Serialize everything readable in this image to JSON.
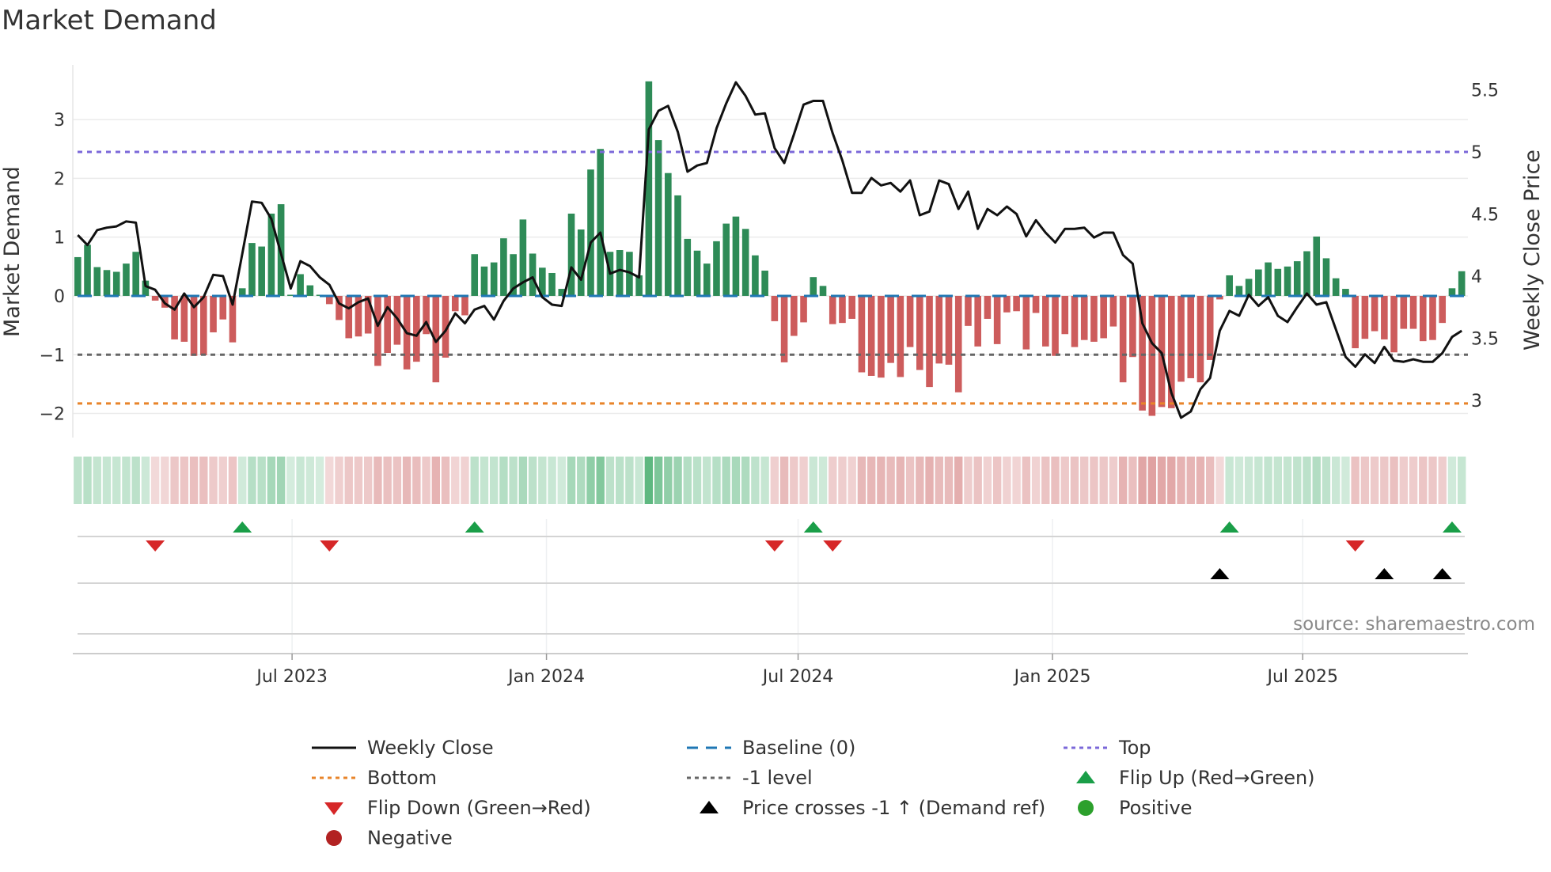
{
  "title": "Market Demand",
  "source": "source: sharemaestro.com",
  "legend": [
    {
      "key": "weekly_close",
      "label": "Weekly Close",
      "color": "#111111",
      "style": "line"
    },
    {
      "key": "baseline",
      "label": "Baseline (0)",
      "color": "#1f77b4",
      "style": "dash"
    },
    {
      "key": "top",
      "label": "Top",
      "color": "#7b68d9",
      "style": "dot"
    },
    {
      "key": "bottom",
      "label": "Bottom",
      "color": "#e8842a",
      "style": "dot"
    },
    {
      "key": "minus1",
      "label": "-1 level",
      "color": "#666666",
      "style": "dot"
    },
    {
      "key": "flip_up",
      "label": "Flip Up (Red→Green)",
      "color": "#1a9e48",
      "style": "tri-up"
    },
    {
      "key": "flip_down",
      "label": "Flip Down (Green→Red)",
      "color": "#d62728",
      "style": "tri-down"
    },
    {
      "key": "price_cross",
      "label": "Price crosses -1 ↑ (Demand ref)",
      "color": "#000000",
      "style": "tri-up"
    },
    {
      "key": "positive",
      "label": "Positive",
      "color": "#2ca02c",
      "style": "circle"
    },
    {
      "key": "negative",
      "label": "Negative",
      "color": "#b22222",
      "style": "circle"
    }
  ],
  "chart_data": {
    "type": "bar",
    "title": "Market Demand",
    "ylabel": "Market Demand",
    "y2label": "Weekly Close Price",
    "frequency": "weekly",
    "start_date": "2023-01-27",
    "ylim": [
      -2.41,
      3.93
    ],
    "y2lim": [
      2.7,
      5.7
    ],
    "yticks": [
      3,
      2,
      1,
      0,
      -1,
      -2
    ],
    "ytick_labels": [
      "3",
      "2",
      "1",
      "0",
      "−1",
      "−2"
    ],
    "y2ticks": [
      5.5,
      5,
      4.5,
      4,
      3.5,
      3
    ],
    "y2tick_labels": [
      "5.5",
      "5",
      "4.5",
      "4",
      "3.5",
      "3"
    ],
    "xticks": [
      "2023-07-01",
      "2024-01-01",
      "2024-07-01",
      "2025-01-01",
      "2025-07-01"
    ],
    "xtick_labels": [
      "Jul 2023",
      "Jan 2024",
      "Jul 2024",
      "Jan 2025",
      "Jul 2025"
    ],
    "reference_lines": {
      "baseline": 0,
      "top": 2.45,
      "minus1": -1,
      "bottom": -1.83
    },
    "colors": {
      "positive_bar": "#2e8b57",
      "negative_bar": "#cd5c5c",
      "strip_pos": "#3aa864",
      "strip_neg": "#c85a5a"
    },
    "demand": [
      0.66,
      0.87,
      0.49,
      0.44,
      0.41,
      0.55,
      0.75,
      0.26,
      -0.08,
      -0.2,
      -0.74,
      -0.78,
      -1.02,
      -1.01,
      -0.62,
      -0.4,
      -0.79,
      0.13,
      0.9,
      0.84,
      1.4,
      1.56,
      0.02,
      0.37,
      0.18,
      0.02,
      -0.14,
      -0.41,
      -0.72,
      -0.69,
      -0.64,
      -1.19,
      -0.97,
      -0.83,
      -1.25,
      -1.12,
      -0.65,
      -1.47,
      -1.05,
      -0.26,
      -0.33,
      0.71,
      0.5,
      0.57,
      0.98,
      0.71,
      1.3,
      0.72,
      0.48,
      0.39,
      0.12,
      1.4,
      1.13,
      2.15,
      2.5,
      0.75,
      0.78,
      0.75,
      0.35,
      3.65,
      2.65,
      2.09,
      1.71,
      0.97,
      0.77,
      0.55,
      0.93,
      1.23,
      1.35,
      1.14,
      0.69,
      0.43,
      -0.43,
      -1.13,
      -0.68,
      -0.45,
      0.32,
      0.17,
      -0.48,
      -0.46,
      -0.39,
      -1.3,
      -1.36,
      -1.39,
      -1.14,
      -1.38,
      -0.87,
      -1.26,
      -1.55,
      -1.15,
      -1.17,
      -1.64,
      -0.51,
      -0.86,
      -0.39,
      -0.82,
      -0.28,
      -0.26,
      -0.91,
      -0.29,
      -0.86,
      -1.02,
      -0.65,
      -0.87,
      -0.75,
      -0.78,
      -0.72,
      -0.52,
      -1.47,
      -1.04,
      -1.95,
      -2.04,
      -1.89,
      -1.91,
      -1.46,
      -1.4,
      -1.47,
      -1.09,
      -0.06,
      0.35,
      0.17,
      0.29,
      0.45,
      0.57,
      0.46,
      0.5,
      0.59,
      0.76,
      1.01,
      0.64,
      0.3,
      0.12,
      -0.89,
      -0.73,
      -0.6,
      -0.74,
      -0.96,
      -0.56,
      -0.56,
      -0.77,
      -0.75,
      -0.46,
      0.13,
      0.42
    ],
    "weekly_close": [
      4.33,
      4.25,
      4.37,
      4.39,
      4.4,
      4.44,
      4.43,
      3.92,
      3.89,
      3.78,
      3.73,
      3.86,
      3.75,
      3.83,
      4.01,
      4.0,
      3.77,
      4.18,
      4.6,
      4.59,
      4.46,
      4.18,
      3.9,
      4.12,
      4.08,
      3.99,
      3.93,
      3.78,
      3.74,
      3.79,
      3.82,
      3.6,
      3.75,
      3.66,
      3.54,
      3.52,
      3.63,
      3.47,
      3.56,
      3.7,
      3.62,
      3.73,
      3.76,
      3.65,
      3.8,
      3.9,
      3.95,
      3.99,
      3.83,
      3.77,
      3.76,
      4.07,
      3.97,
      4.27,
      4.35,
      4.02,
      4.05,
      4.03,
      3.99,
      5.18,
      5.33,
      5.37,
      5.16,
      4.84,
      4.89,
      4.91,
      5.19,
      5.39,
      5.56,
      5.45,
      5.3,
      5.31,
      5.03,
      4.91,
      5.14,
      5.38,
      5.41,
      5.41,
      5.15,
      4.93,
      4.67,
      4.67,
      4.79,
      4.73,
      4.75,
      4.68,
      4.77,
      4.49,
      4.52,
      4.77,
      4.74,
      4.54,
      4.68,
      4.38,
      4.54,
      4.49,
      4.56,
      4.5,
      4.32,
      4.45,
      4.35,
      4.27,
      4.38,
      4.38,
      4.39,
      4.31,
      4.35,
      4.35,
      4.17,
      4.1,
      3.62,
      3.46,
      3.38,
      3.06,
      2.86,
      2.91,
      3.09,
      3.18,
      3.56,
      3.72,
      3.68,
      3.85,
      3.76,
      3.83,
      3.68,
      3.63,
      3.75,
      3.86,
      3.77,
      3.79,
      3.57,
      3.35,
      3.27,
      3.37,
      3.3,
      3.43,
      3.32,
      3.31,
      3.33,
      3.31,
      3.31,
      3.38,
      3.51,
      3.56
    ],
    "flip_up_weeks": [
      17,
      41,
      76,
      119,
      142
    ],
    "flip_down_weeks": [
      8,
      26,
      72,
      78,
      132
    ],
    "price_cross_weeks": [
      118,
      135,
      141
    ]
  }
}
